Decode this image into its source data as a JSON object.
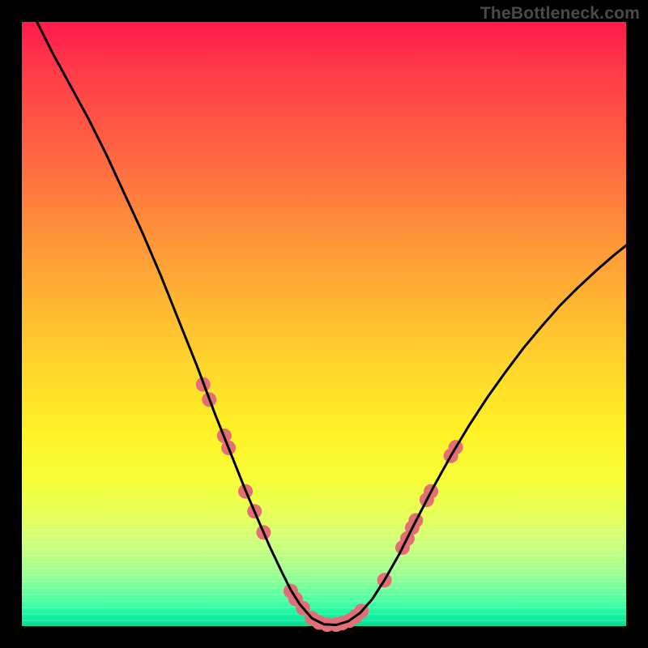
{
  "watermark": {
    "text": "TheBottleneck.com"
  },
  "chart_data": {
    "type": "line",
    "title": "",
    "xlabel": "",
    "ylabel": "",
    "xlim": [
      0,
      100
    ],
    "ylim": [
      0,
      100
    ],
    "x": [
      0,
      2,
      5,
      8,
      11,
      14,
      17,
      20,
      23,
      26,
      29,
      32,
      35,
      37,
      39,
      41,
      43,
      44.5,
      46,
      48,
      50,
      52,
      54,
      56,
      58,
      60,
      62.5,
      65,
      68,
      71,
      74,
      77,
      80,
      83,
      86,
      89,
      92,
      95,
      98,
      100
    ],
    "y": [
      105,
      101,
      95,
      89.5,
      84,
      78,
      71.5,
      65,
      58,
      50.5,
      43,
      35,
      27.5,
      22.5,
      17.8,
      13.2,
      9,
      6,
      3.6,
      1.3,
      0.3,
      0.2,
      0.8,
      2.2,
      4.5,
      7.6,
      12,
      17,
      22.8,
      28.2,
      33.2,
      37.8,
      42,
      46,
      49.6,
      53,
      56,
      58.8,
      61.4,
      63
    ],
    "series": [
      {
        "name": "bottleneck-curve",
        "color": "#000000",
        "stroke_width": 3
      }
    ],
    "markers": {
      "name": "highlighted-points",
      "color": "#e36f76",
      "radius": 9,
      "points": [
        {
          "x": 30.0,
          "y": 40.0
        },
        {
          "x": 31.0,
          "y": 37.5
        },
        {
          "x": 33.5,
          "y": 31.5
        },
        {
          "x": 34.2,
          "y": 29.5
        },
        {
          "x": 37.0,
          "y": 22.3
        },
        {
          "x": 38.5,
          "y": 19.0
        },
        {
          "x": 40.0,
          "y": 15.5
        },
        {
          "x": 44.5,
          "y": 5.8
        },
        {
          "x": 45.3,
          "y": 4.5
        },
        {
          "x": 46.5,
          "y": 3.0
        },
        {
          "x": 48.0,
          "y": 1.3
        },
        {
          "x": 49.2,
          "y": 0.6
        },
        {
          "x": 50.5,
          "y": 0.25
        },
        {
          "x": 52.0,
          "y": 0.25
        },
        {
          "x": 53.0,
          "y": 0.5
        },
        {
          "x": 54.2,
          "y": 0.9
        },
        {
          "x": 55.2,
          "y": 1.6
        },
        {
          "x": 56.2,
          "y": 2.5
        },
        {
          "x": 60.0,
          "y": 7.6
        },
        {
          "x": 63.0,
          "y": 13.0
        },
        {
          "x": 63.8,
          "y": 14.5
        },
        {
          "x": 64.6,
          "y": 16.3
        },
        {
          "x": 65.2,
          "y": 17.5
        },
        {
          "x": 67.0,
          "y": 20.9
        },
        {
          "x": 67.7,
          "y": 22.3
        },
        {
          "x": 71.0,
          "y": 28.2
        },
        {
          "x": 71.8,
          "y": 29.6
        }
      ]
    },
    "grid": false,
    "legend": null,
    "background_gradient": {
      "stops": [
        {
          "pos": 0.0,
          "color": "#ff1a4d"
        },
        {
          "pos": 0.5,
          "color": "#ffbb32"
        },
        {
          "pos": 0.75,
          "color": "#f7ff3a"
        },
        {
          "pos": 1.0,
          "color": "#08d892"
        }
      ]
    }
  }
}
